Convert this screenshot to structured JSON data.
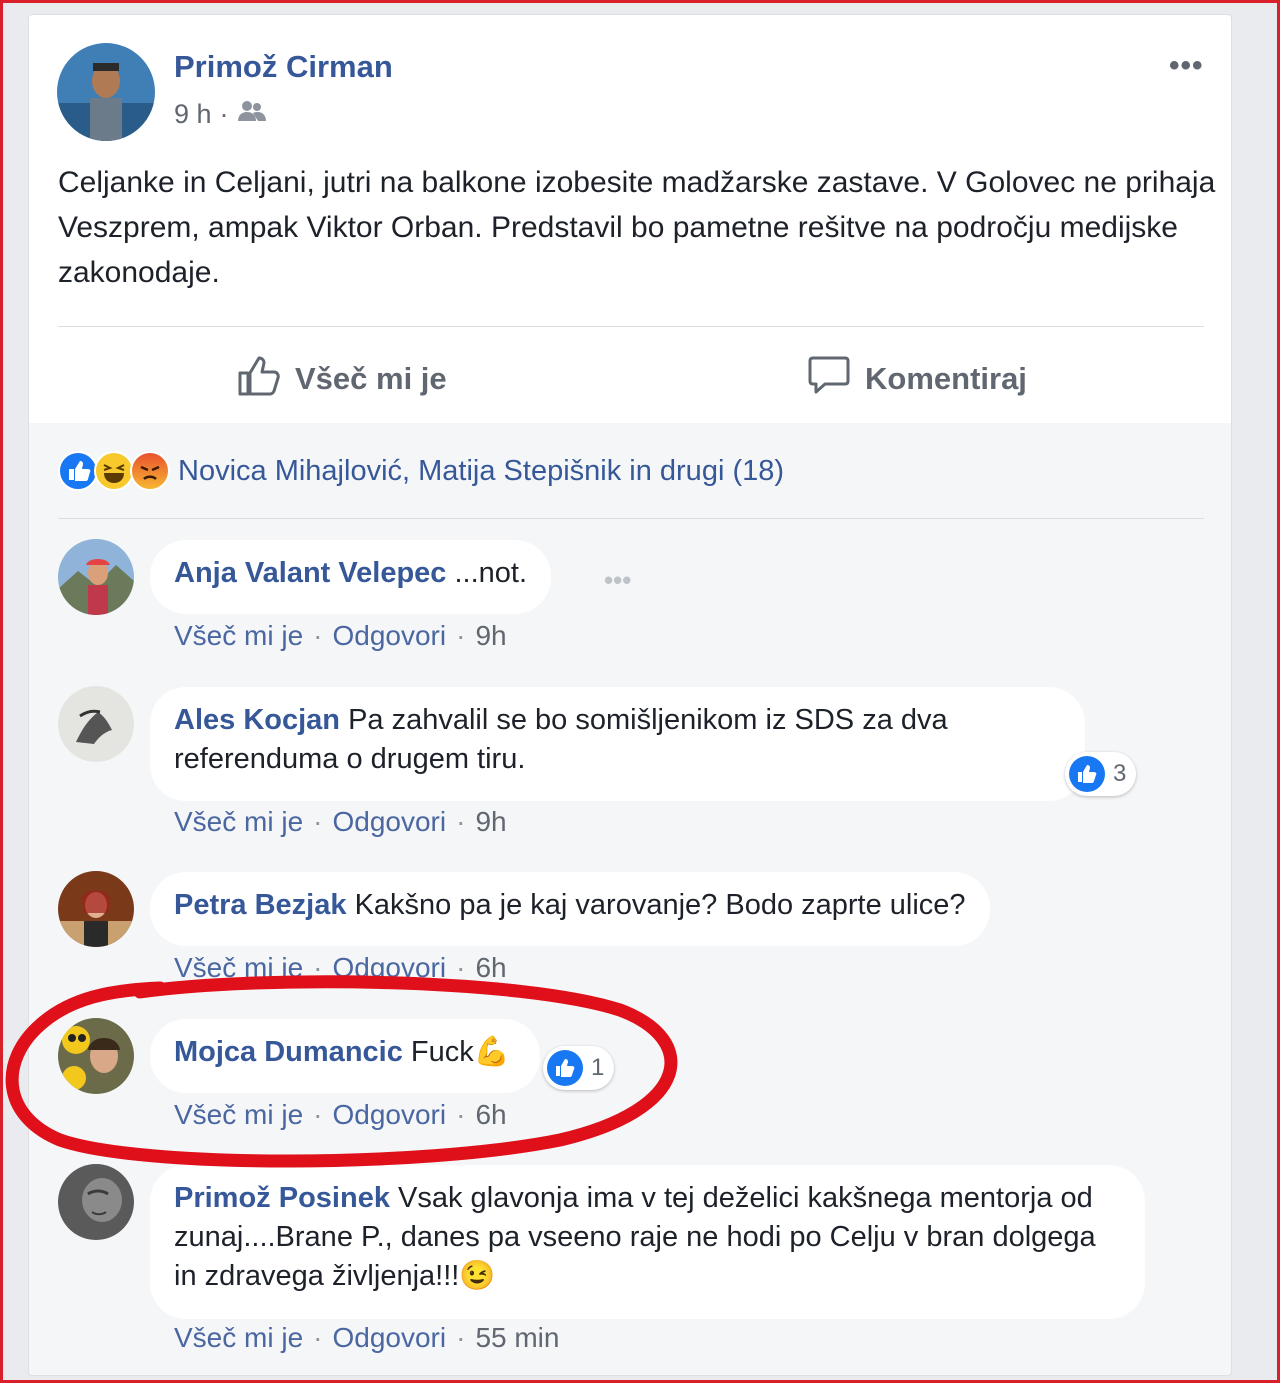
{
  "post": {
    "author": "Primož Cirman",
    "time": "9 h",
    "separator": "·",
    "audience_icon": "friends-icon",
    "more_icon": "more-options-icon",
    "more_label": "•••",
    "text": "Celjanke in Celjani, jutri na balkone izobesite madžarske zastave. V Golovec ne prihaja Veszprem, ampak Viktor Orban. Predstavil bo pametne rešitve na področju medijske zakonodaje."
  },
  "actions": {
    "like_label": "Všeč mi je",
    "comment_label": "Komentiraj"
  },
  "reactions": {
    "icons": [
      "like-reaction-icon",
      "haha-reaction-icon",
      "angry-reaction-icon"
    ],
    "summary": "Novica Mihajlović, Matija Stepišnik in drugi (18)"
  },
  "comments": [
    {
      "name": "Anja Valant Velepec",
      "text": "...not.",
      "like": "Všeč mi je",
      "reply": "Odgovori",
      "time": "9h",
      "more_label": "•••"
    },
    {
      "name": "Ales Kocjan",
      "text": "Pa zahvalil se bo somišljenikom iz SDS za dva referenduma o drugem tiru.",
      "like": "Všeč mi je",
      "reply": "Odgovori",
      "time": "9h",
      "like_count": "3"
    },
    {
      "name": "Petra Bezjak",
      "text": "Kakšno pa je kaj varovanje? Bodo zaprte ulice?",
      "like": "Všeč mi je",
      "reply": "Odgovori",
      "time": "6h"
    },
    {
      "name": "Mojca Dumancic",
      "text": "Fuck",
      "emoji": "💪",
      "like": "Všeč mi je",
      "reply": "Odgovori",
      "time": "6h",
      "like_count": "1"
    },
    {
      "name": "Primož Posinek",
      "text": "Vsak glavonja ima v tej deželici kakšnega mentorja od zunaj....Brane P., danes pa vseeno raje ne hodi po Celju v bran dolgega in zdravega življenja!!!",
      "emoji": "😉",
      "like": "Všeč mi je",
      "reply": "Odgovori",
      "time": "55 min"
    }
  ],
  "colors": {
    "link_blue": "#365899",
    "like_blue": "#1877f2",
    "highlight_red": "#e0101a",
    "frame_red": "#d9202a"
  }
}
